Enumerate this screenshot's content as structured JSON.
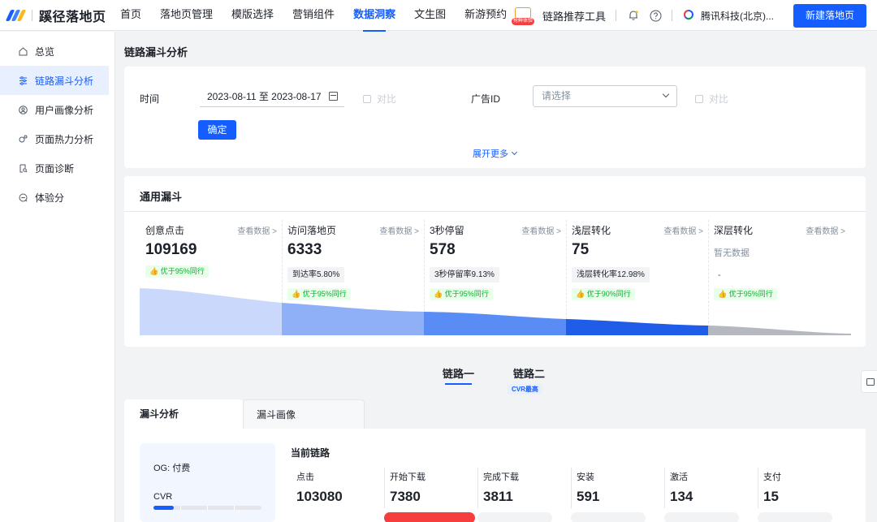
{
  "brand": {
    "name": "蹊径落地页"
  },
  "nav": {
    "items": [
      {
        "label": "首页"
      },
      {
        "label": "落地页管理"
      },
      {
        "label": "模版选择"
      },
      {
        "label": "营销组件"
      },
      {
        "label": "数据洞察"
      },
      {
        "label": "文生图"
      },
      {
        "label": "新游预约"
      }
    ],
    "active": "数据洞察",
    "tool_badge": "抢鲜体验",
    "tool_label": "链路推荐工具",
    "company": "腾讯科技(北京)...",
    "new_button": "新建落地页"
  },
  "sidebar": {
    "items": [
      {
        "label": "总览",
        "icon": "home-icon"
      },
      {
        "label": "链路漏斗分析",
        "icon": "funnel-icon",
        "active": true
      },
      {
        "label": "用户画像分析",
        "icon": "user-icon"
      },
      {
        "label": "页面热力分析",
        "icon": "heatmap-icon"
      },
      {
        "label": "页面诊断",
        "icon": "diagnosis-icon"
      },
      {
        "label": "体验分",
        "icon": "score-icon"
      }
    ]
  },
  "page": {
    "title": "链路漏斗分析"
  },
  "filters": {
    "time_label": "时间",
    "date_range": "2023-08-11 至 2023-08-17",
    "compare_label": "对比",
    "ad_id_label": "广告ID",
    "ad_id_placeholder": "请选择",
    "confirm": "确定",
    "expand_more": "展开更多"
  },
  "funnel": {
    "title": "通用漏斗",
    "view_data": "查看数据 >",
    "stages": [
      {
        "name": "创意点击",
        "value": "109169",
        "rate": "",
        "benchmark": "优于95%同行"
      },
      {
        "name": "访问落地页",
        "value": "6333",
        "rate": "到达率5.80%",
        "benchmark": "优于95%同行"
      },
      {
        "name": "3秒停留",
        "value": "578",
        "rate": "3秒停留率9.13%",
        "benchmark": "优于95%同行"
      },
      {
        "name": "浅层转化",
        "value": "75",
        "rate": "浅层转化率12.98%",
        "benchmark": "优于90%同行"
      },
      {
        "name": "深层转化",
        "value": "",
        "empty": "暂无数据",
        "rate": "-",
        "benchmark": "优于95%同行"
      }
    ],
    "colors": [
      "#c9d8fb",
      "#8fb0f7",
      "#5a8cf5",
      "#1f5ce8",
      "#b5b8bf"
    ]
  },
  "routes": {
    "tabs": [
      {
        "label": "链路一"
      },
      {
        "label": "链路二"
      }
    ],
    "cvr_badge": "CVR最高"
  },
  "analysis": {
    "tabs": [
      {
        "label": "漏斗分析"
      },
      {
        "label": "漏斗画像"
      }
    ],
    "og_label": "OG: 付费",
    "cvr_label": "CVR",
    "cvr_fill": 0.19,
    "current_title": "当前链路",
    "steps": [
      {
        "name": "点击",
        "value": "103080"
      },
      {
        "name": "开始下载",
        "value": "7380"
      },
      {
        "name": "完成下载",
        "value": "3811"
      },
      {
        "name": "安装",
        "value": "591"
      },
      {
        "name": "激活",
        "value": "134"
      },
      {
        "name": "支付",
        "value": "15"
      }
    ]
  }
}
